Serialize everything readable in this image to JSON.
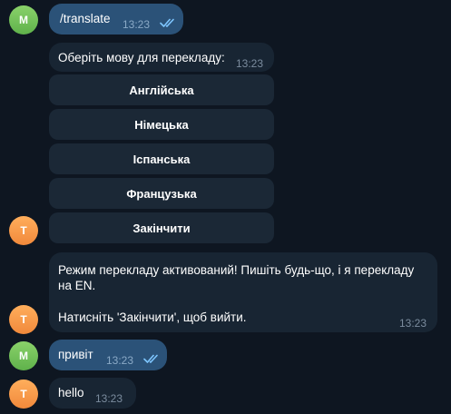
{
  "messages": [
    {
      "sender_initial": "M",
      "text": "/translate",
      "time": "13:23"
    },
    {
      "sender_initial": "",
      "text": "Оберіть мову для перекладу:",
      "time": "13:23"
    },
    {
      "sender_initial": "T",
      "text_line1": "Режим перекладу активований! Пишіть будь-що, і я перекладу",
      "text_line2": "на EN.",
      "text_line3": "Натисніть 'Закінчити', щоб вийти.",
      "time": "13:23"
    },
    {
      "sender_initial": "M",
      "text": "привіт",
      "time": "13:23"
    },
    {
      "sender_initial": "T",
      "text": "hello",
      "time": "13:23"
    }
  ],
  "keyboard": {
    "buttons": [
      "Англійська",
      "Німецька",
      "Іспанська",
      "Французька",
      "Закінчити"
    ]
  },
  "icons": {
    "read": "double-check-icon"
  },
  "colors": {
    "background": "#0e1621",
    "outgoing_bubble": "#2b5278",
    "incoming_bubble": "#182533",
    "avatar_m": "#6fc05a",
    "avatar_t": "#f89a4a"
  }
}
